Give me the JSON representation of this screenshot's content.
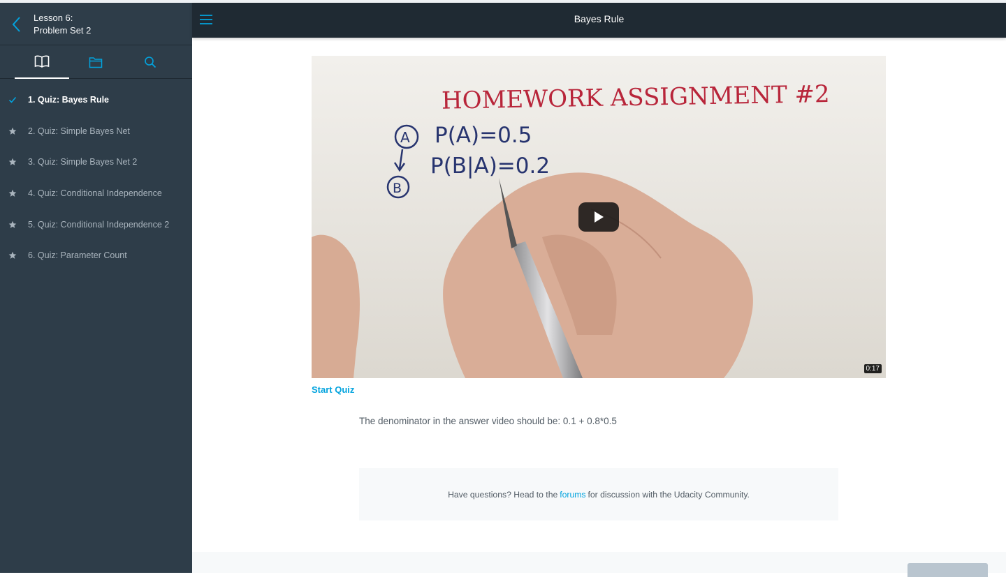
{
  "sidebar": {
    "lesson_number": "Lesson 6:",
    "lesson_title": "Problem Set 2",
    "tabs": [
      {
        "icon": "book-icon"
      },
      {
        "icon": "folder-icon"
      },
      {
        "icon": "search-icon"
      }
    ],
    "items": [
      {
        "label": "1. Quiz: Bayes Rule",
        "status": "check-icon"
      },
      {
        "label": "2. Quiz: Simple Bayes Net",
        "status": "star-icon"
      },
      {
        "label": "3. Quiz: Simple Bayes Net 2",
        "status": "star-icon"
      },
      {
        "label": "4. Quiz: Conditional Independence",
        "status": "star-icon"
      },
      {
        "label": "5. Quiz: Conditional Independence 2",
        "status": "star-icon"
      },
      {
        "label": "6. Quiz: Parameter Count",
        "status": "star-icon"
      }
    ]
  },
  "header": {
    "title": "Bayes Rule"
  },
  "video": {
    "handwriting": {
      "title": "HOMEWORK ASSIGNMENT #2",
      "line1": "P(A)=0.5",
      "line2": "P(B|A)=0.2",
      "node_a": "A",
      "node_b": "B"
    },
    "duration": "0:17"
  },
  "main": {
    "start_quiz_label": "Start Quiz",
    "note": "The denominator in the answer video should be: 0.1 + 0.8*0.5",
    "questions_prefix": "Have questions? Head to the",
    "forums_link": "forums",
    "questions_suffix": "for discussion with the Udacity Community."
  },
  "colors": {
    "sidebar_bg": "#2e3d49",
    "topbar_bg": "#1f2a33",
    "accent": "#02a3de",
    "ink_red": "#b8253a",
    "ink_blue": "#27346f"
  }
}
